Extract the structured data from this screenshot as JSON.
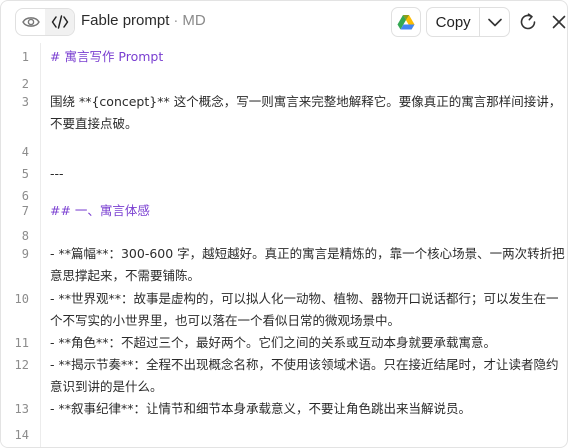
{
  "toolbar": {
    "title": "Fable prompt",
    "separator": "·",
    "file_type": "MD",
    "copy_label": "Copy",
    "icons": {
      "preview": "eye-icon",
      "code": "code-icon",
      "drive": "google-drive-icon",
      "caret": "chevron-down-icon",
      "reload": "reload-icon",
      "close": "close-icon"
    }
  },
  "editor": {
    "lines": [
      {
        "num": "1",
        "text": "# 寓言写作 Prompt",
        "kind": "heading"
      },
      {
        "num": "2",
        "text": "",
        "kind": "text"
      },
      {
        "num": "3",
        "text": "围绕 **{concept}** 这个概念，写一则寓言来完整地解释它。要像真正的寓言那样间接讲，不要直接点破。",
        "kind": "text"
      },
      {
        "num": "4",
        "text": "",
        "kind": "text"
      },
      {
        "num": "5",
        "text": "---",
        "kind": "text"
      },
      {
        "num": "6",
        "text": "",
        "kind": "text"
      },
      {
        "num": "7",
        "text": "## 一、寓言体感",
        "kind": "heading"
      },
      {
        "num": "8",
        "text": "",
        "kind": "text"
      },
      {
        "num": "9",
        "text": "- **篇幅**：300-600 字，越短越好。真正的寓言是精炼的，靠一个核心场景、一两次转折把意思撑起来，不需要铺陈。",
        "kind": "text"
      },
      {
        "num": "10",
        "text": "- **世界观**：故事是虚构的，可以拟人化一动物、植物、器物开口说话都行；可以发生在一个不写实的小世界里，也可以落在一个看似日常的微观场景中。",
        "kind": "text"
      },
      {
        "num": "11",
        "text": "- **角色**：不超过三个，最好两个。它们之间的关系或互动本身就要承载寓意。",
        "kind": "text"
      },
      {
        "num": "12",
        "text": "- **揭示节奏**：全程不出现概念名称，不使用该领域术语。只在接近结尾时，才让读者隐约意识到讲的是什么。",
        "kind": "text"
      },
      {
        "num": "13",
        "text": "- **叙事纪律**：让情节和细节本身承载意义，不要让角色跳出来当解说员。",
        "kind": "text"
      },
      {
        "num": "14",
        "text": "",
        "kind": "text"
      }
    ]
  }
}
